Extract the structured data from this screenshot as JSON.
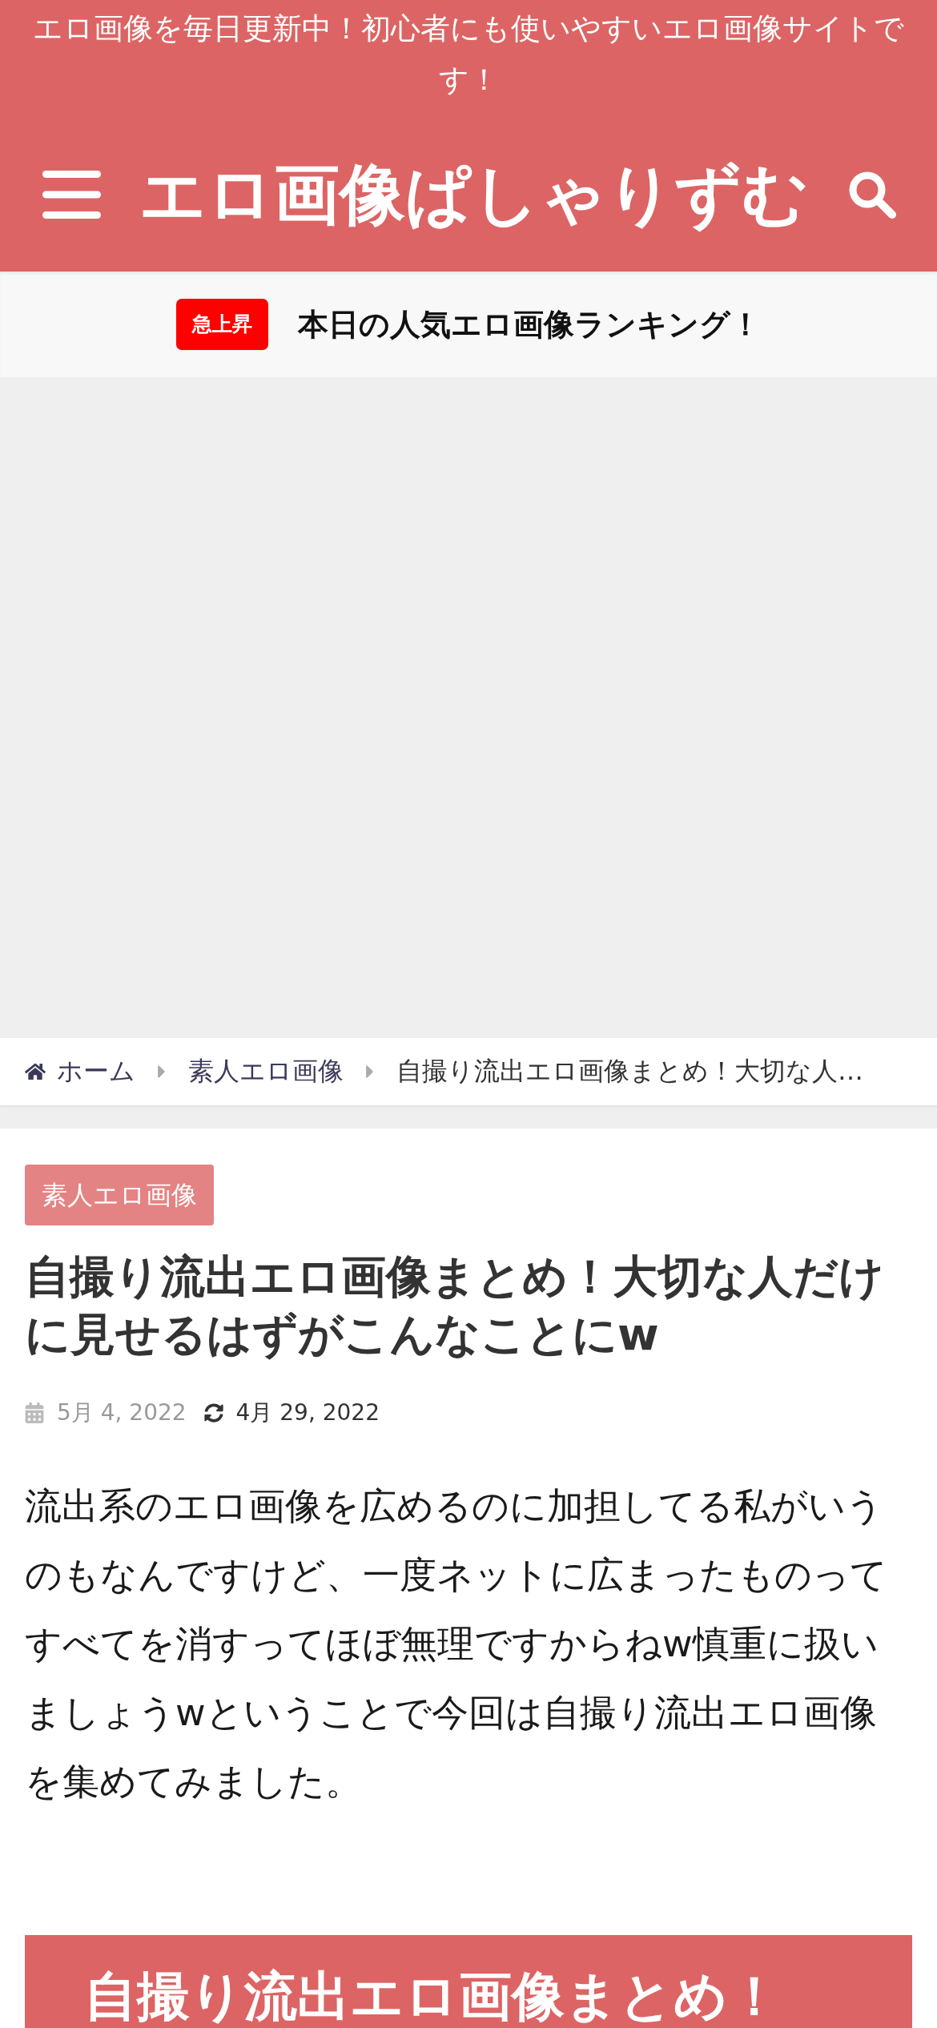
{
  "header": {
    "tagline": "エロ画像を毎日更新中！初心者にも使いやすいエロ画像サイトです！",
    "logo": "エロ画像ぱしゃりずむ"
  },
  "ticker": {
    "badge": "急上昇",
    "text": "本日の人気エロ画像ランキング！"
  },
  "breadcrumb": [
    {
      "label": "ホーム",
      "kind": "home"
    },
    {
      "label": "素人エロ画像",
      "kind": "link"
    },
    {
      "label": "自撮り流出エロ画像まとめ！大切な人…",
      "kind": "current"
    }
  ],
  "article": {
    "category": "素人エロ画像",
    "title": "自撮り流出エロ画像まとめ！大切な人だけに見せるはずがこんなことにw",
    "published": "5月 4, 2022",
    "updated": "4月 29, 2022",
    "intro": "流出系のエロ画像を広めるのに加担してる私がいうのもなんですけど、一度ネットに広まったものってすべてを消すってほぼ無理ですからねw慎重に扱いましょうwということで今回は自撮り流出エロ画像を集めてみました。",
    "heading": "自撮り流出エロ画像まとめ！"
  }
}
